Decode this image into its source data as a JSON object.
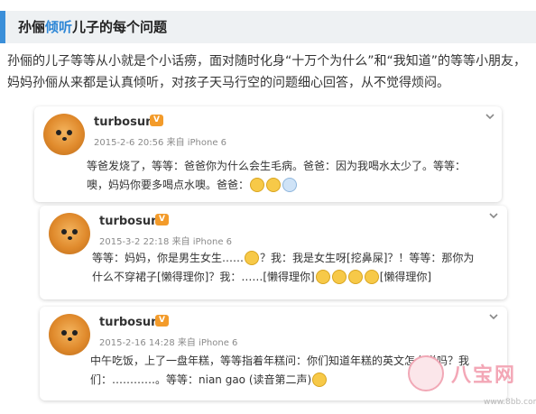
{
  "headline": {
    "part1": "孙俪",
    "highlight": "倾听",
    "part2": "儿子的每个问题"
  },
  "intro": "孙俪的儿子等等从小就是个小话痨，面对随时化身“十万个为什么”和“我知道”的等等小朋友，妈妈孙俪从来都是认真倾听，对孩子天马行空的问题细心回答，从不觉得烦闷。",
  "posts": [
    {
      "username": "turbosun",
      "meta": "2015-2-6 20:56 来自 iPhone 6",
      "line1": "等爸发烧了，等等：爸爸你为什么会生毛病。爸爸：因为我喝水太少了。等等：",
      "line2": "噢，妈妈你要多喝点水噢。爸爸："
    },
    {
      "username": "turbosun",
      "meta": "2015-3-2 22:18 来自 iPhone 6",
      "line1a": "等等：妈妈，你是男生女生……",
      "line1b": "？我：我是女生呀[挖鼻屎]？！等等：那你为",
      "line2a": "什么不穿裙子[懒得理你]？我：……[懒得理你]",
      "line2b": "[懒得理你]"
    },
    {
      "username": "turbosun",
      "meta": "2015-2-16 14:28 来自 iPhone 6",
      "line1": "中午吃饭，上了一盘年糕，等等指着年糕问：你们知道年糕的英文怎么说吗？我",
      "line2": "们：…………。等等：nian gao (读音第二声)"
    }
  ],
  "badge_label": "V",
  "watermark": {
    "name": "八宝网",
    "url": "www.8bb.com"
  },
  "colors": {
    "accent": "#3b8fd9",
    "highlight": "#2c86d6",
    "badge": "#f39b2a"
  }
}
